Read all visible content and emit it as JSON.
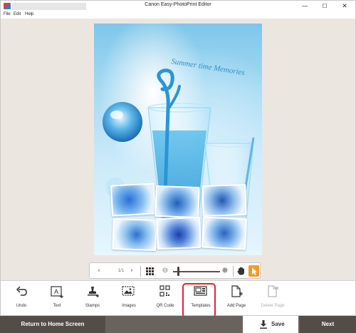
{
  "window": {
    "title": "Canon Easy-PhotoPrint Editor",
    "min_glyph": "—",
    "max_glyph": "☐",
    "close_glyph": "✕"
  },
  "menu": {
    "file": "File",
    "edit": "Edit",
    "help": "Help"
  },
  "page": {
    "caption": "Summer time Memories",
    "photo_count": 6
  },
  "view_toolbar": {
    "page_indicator": "1/1",
    "prev_glyph": "‹",
    "next_glyph": "›",
    "zoom_out_glyph": "⊖",
    "zoom_in_glyph": "⊕",
    "zoom_level": 0.1
  },
  "tools": {
    "undo": "Undo",
    "text": "Text",
    "stamps": "Stamps",
    "images": "Images",
    "qr_code": "QR Code",
    "templates": "Templates",
    "add_page": "Add Page",
    "delete_page": "Delete Page"
  },
  "footer": {
    "home": "Return to Home Screen",
    "save": "Save",
    "next": "Next"
  },
  "colors": {
    "accent_orange": "#f59a23",
    "highlight_red": "#e3232b",
    "footer_dark": "#544c47",
    "workspace_bg": "#ece6e1"
  }
}
